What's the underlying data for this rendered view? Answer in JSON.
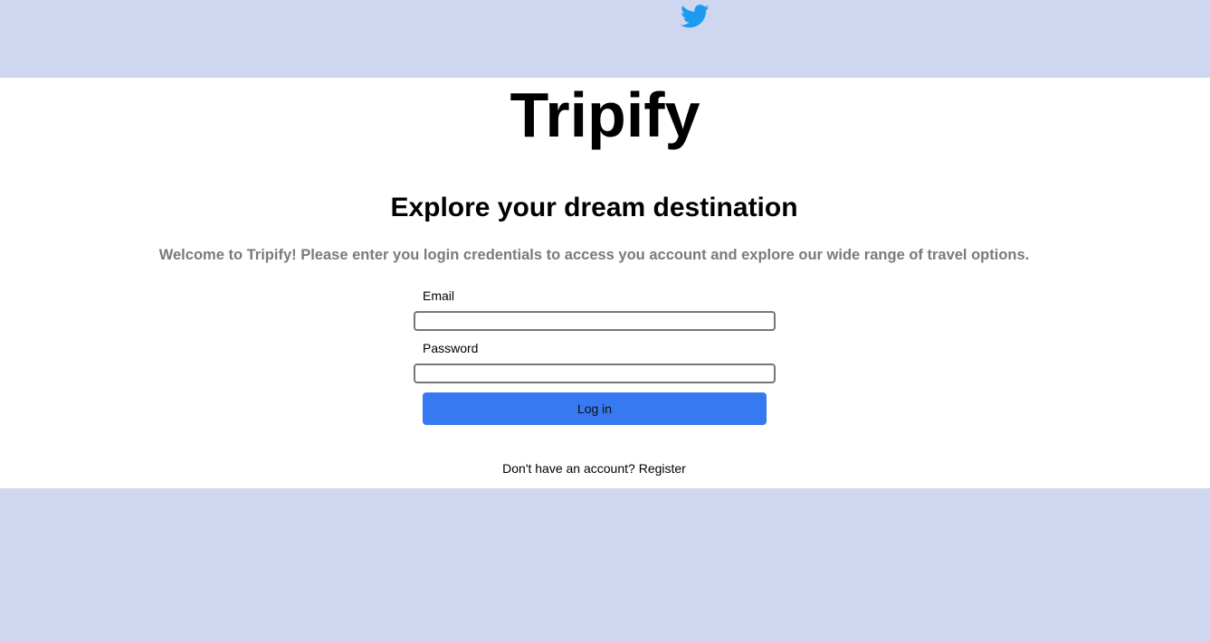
{
  "header": {
    "social_icon": "twitter-icon",
    "social_color": "#1d9bf0",
    "background_color": "#cfd6ef"
  },
  "brand": {
    "title": "Tripify"
  },
  "hero": {
    "headline": "Explore your dream destination",
    "welcome_text": "Welcome to Tripify! Please enter you login credentials to access you account and explore our wide range of travel options."
  },
  "form": {
    "email_label": "Email",
    "email_value": "",
    "password_label": "Password",
    "password_value": "",
    "login_label": "Log in",
    "login_color": "#3679f0"
  },
  "footer": {
    "register_prompt": "Don't have an account?",
    "register_link": "Register"
  }
}
